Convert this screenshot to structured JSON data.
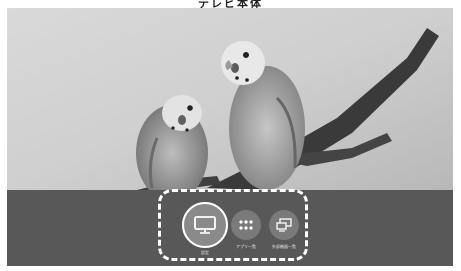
{
  "header": {
    "title": "テレビ本体"
  },
  "menu": {
    "items": [
      {
        "id": "settings",
        "label": "設定",
        "icon": "tv-monitor-icon",
        "selected": true
      },
      {
        "id": "apps",
        "label": "アプリ一覧",
        "icon": "app-grid-icon",
        "selected": false
      },
      {
        "id": "devices",
        "label": "外部機器一覧",
        "icon": "external-devices-icon",
        "selected": false
      }
    ]
  },
  "colors": {
    "menu_bar": "#585858",
    "selected_ring": "#ffffff",
    "highlight_frame": "#ffffff",
    "circle_fill": "#7a7a7a"
  }
}
